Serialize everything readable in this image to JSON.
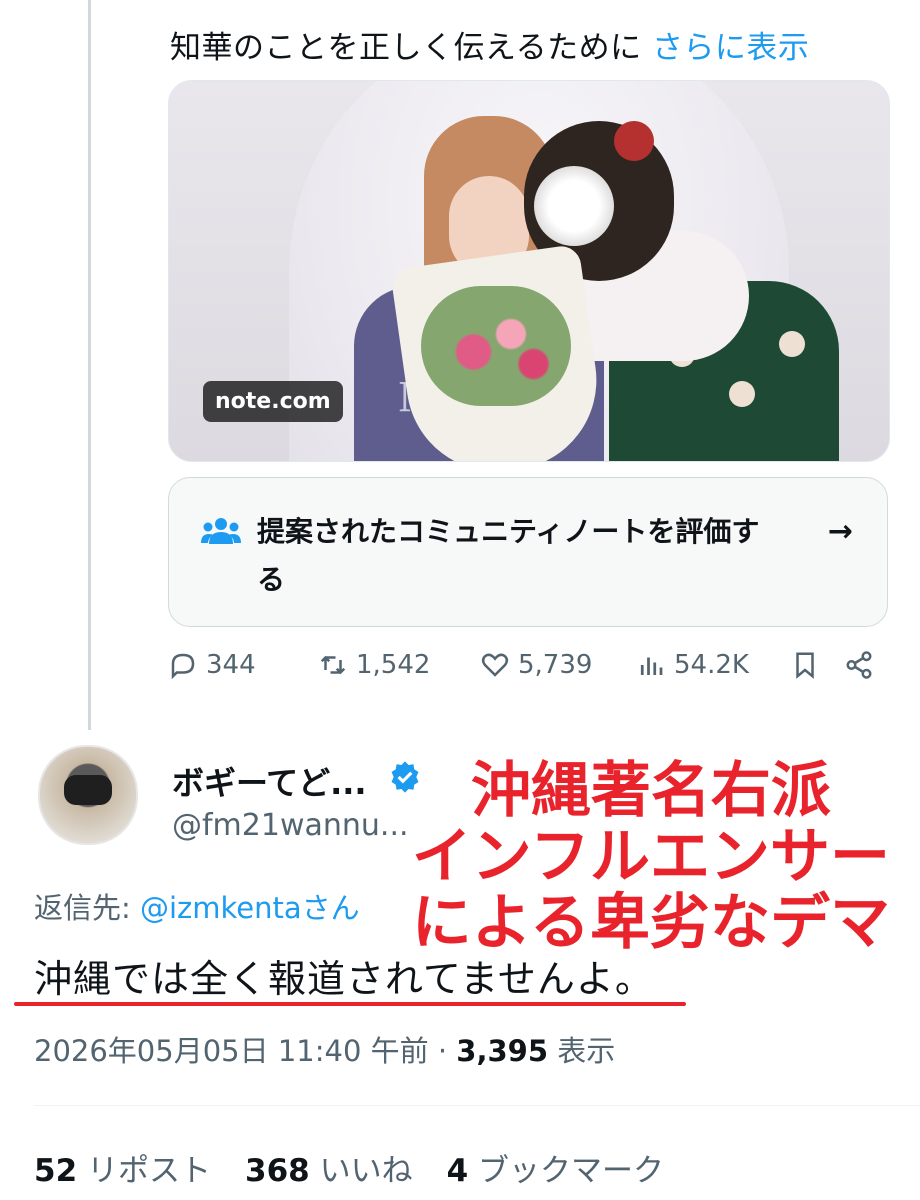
{
  "post": {
    "text": "知華のことを正しく伝えるために",
    "more_link": "さらに表示",
    "media_label": "note.com"
  },
  "community_note": {
    "text": "提案されたコミュニティノートを評価する",
    "arrow": "→"
  },
  "actions": {
    "replies": "344",
    "reposts": "1,542",
    "likes": "5,739",
    "views": "54.2K"
  },
  "reply": {
    "display_name": "ボギーてど...",
    "handle": "@fm21wannu...",
    "reply_to_prefix": "返信先: ",
    "reply_to_handle": "@izmkentaさん",
    "text": "沖縄では全く報道されてませんよ。",
    "timestamp": "2026年05月05日 11:40 午前 · ",
    "view_count": "3,395",
    "view_label": " 表示"
  },
  "overlay": {
    "line1": "沖縄著名右派",
    "line2": "インフルエンサー",
    "line3": "による卑劣なデマ",
    "color": "#e8232b"
  },
  "stats": {
    "reposts_count": "52",
    "reposts_label": "リポスト",
    "likes_count": "368",
    "likes_label": "いいね",
    "bookmarks_count": "4",
    "bookmarks_label": "ブックマーク"
  },
  "colors": {
    "accent": "#1d9bf0",
    "secondary_text": "#536471",
    "verified": "#1d9bf0"
  }
}
